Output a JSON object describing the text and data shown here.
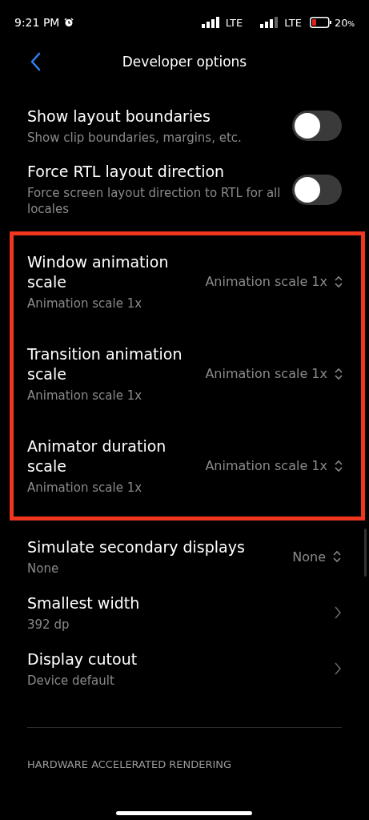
{
  "status_bar": {
    "time": "9:21 PM",
    "network_1": "LTE",
    "network_2": "LTE",
    "battery": "20",
    "battery_unit": "%"
  },
  "header": {
    "title": "Developer options"
  },
  "settings": [
    {
      "kind": "toggle",
      "title": "Show layout boundaries",
      "subtitle": "Show clip boundaries, margins, etc.",
      "on": false,
      "highlighted": false
    },
    {
      "kind": "toggle",
      "title": "Force RTL layout direction",
      "subtitle": "Force screen layout direction to RTL for all locales",
      "on": false,
      "highlighted": false
    },
    {
      "kind": "select",
      "title": "Window animation scale",
      "subtitle": "Animation scale 1x",
      "value": "Animation scale 1x",
      "highlighted": true
    },
    {
      "kind": "select",
      "title": "Transition animation scale",
      "subtitle": "Animation scale 1x",
      "value": "Animation scale 1x",
      "highlighted": true
    },
    {
      "kind": "select",
      "title": "Animator duration scale",
      "subtitle": "Animation scale 1x",
      "value": "Animation scale 1x",
      "highlighted": true
    },
    {
      "kind": "select",
      "title": "Simulate secondary displays",
      "subtitle": "None",
      "value": "None",
      "highlighted": false
    },
    {
      "kind": "link",
      "title": "Smallest width",
      "subtitle": "392 dp",
      "highlighted": false
    },
    {
      "kind": "link",
      "title": "Display cutout",
      "subtitle": "Device default",
      "highlighted": false
    }
  ],
  "section_header": "HARDWARE ACCELERATED RENDERING"
}
